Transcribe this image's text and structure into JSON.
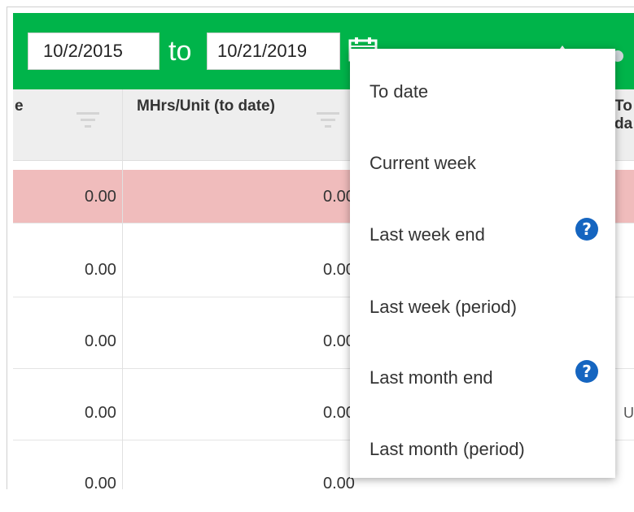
{
  "date_range": {
    "from_value": "10/2/2015",
    "to_word": "to",
    "to_value": "10/21/2019"
  },
  "table": {
    "headers": {
      "col_prev_fragment": "e",
      "mhrs_unit": "MHrs/Unit (to date)",
      "next_fragment": "To da"
    },
    "rows": [
      {
        "col1": "0.00",
        "col2": "0.00",
        "stub": ""
      },
      {
        "col1": "0.00",
        "col2": "0.00",
        "stub": ""
      },
      {
        "col1": "0.00",
        "col2": "0.00",
        "stub": ""
      },
      {
        "col1": "0.00",
        "col2": "0.00",
        "stub": "U"
      },
      {
        "col1": "0.00",
        "col2": "0.00",
        "stub": ""
      }
    ]
  },
  "dropdown": {
    "items": [
      {
        "label": "To date",
        "help": false
      },
      {
        "label": "Current week",
        "help": false
      },
      {
        "label": "Last week end",
        "help": true
      },
      {
        "label": "Last week (period)",
        "help": false
      },
      {
        "label": "Last month end",
        "help": true
      },
      {
        "label": "Last month (period)",
        "help": false
      }
    ]
  },
  "colors": {
    "accent_green": "#00b44a",
    "highlight_row": "#f0bcbc",
    "help_blue": "#1565c0"
  },
  "icons": [
    "calendar-icon",
    "filter-icon",
    "help-icon"
  ]
}
